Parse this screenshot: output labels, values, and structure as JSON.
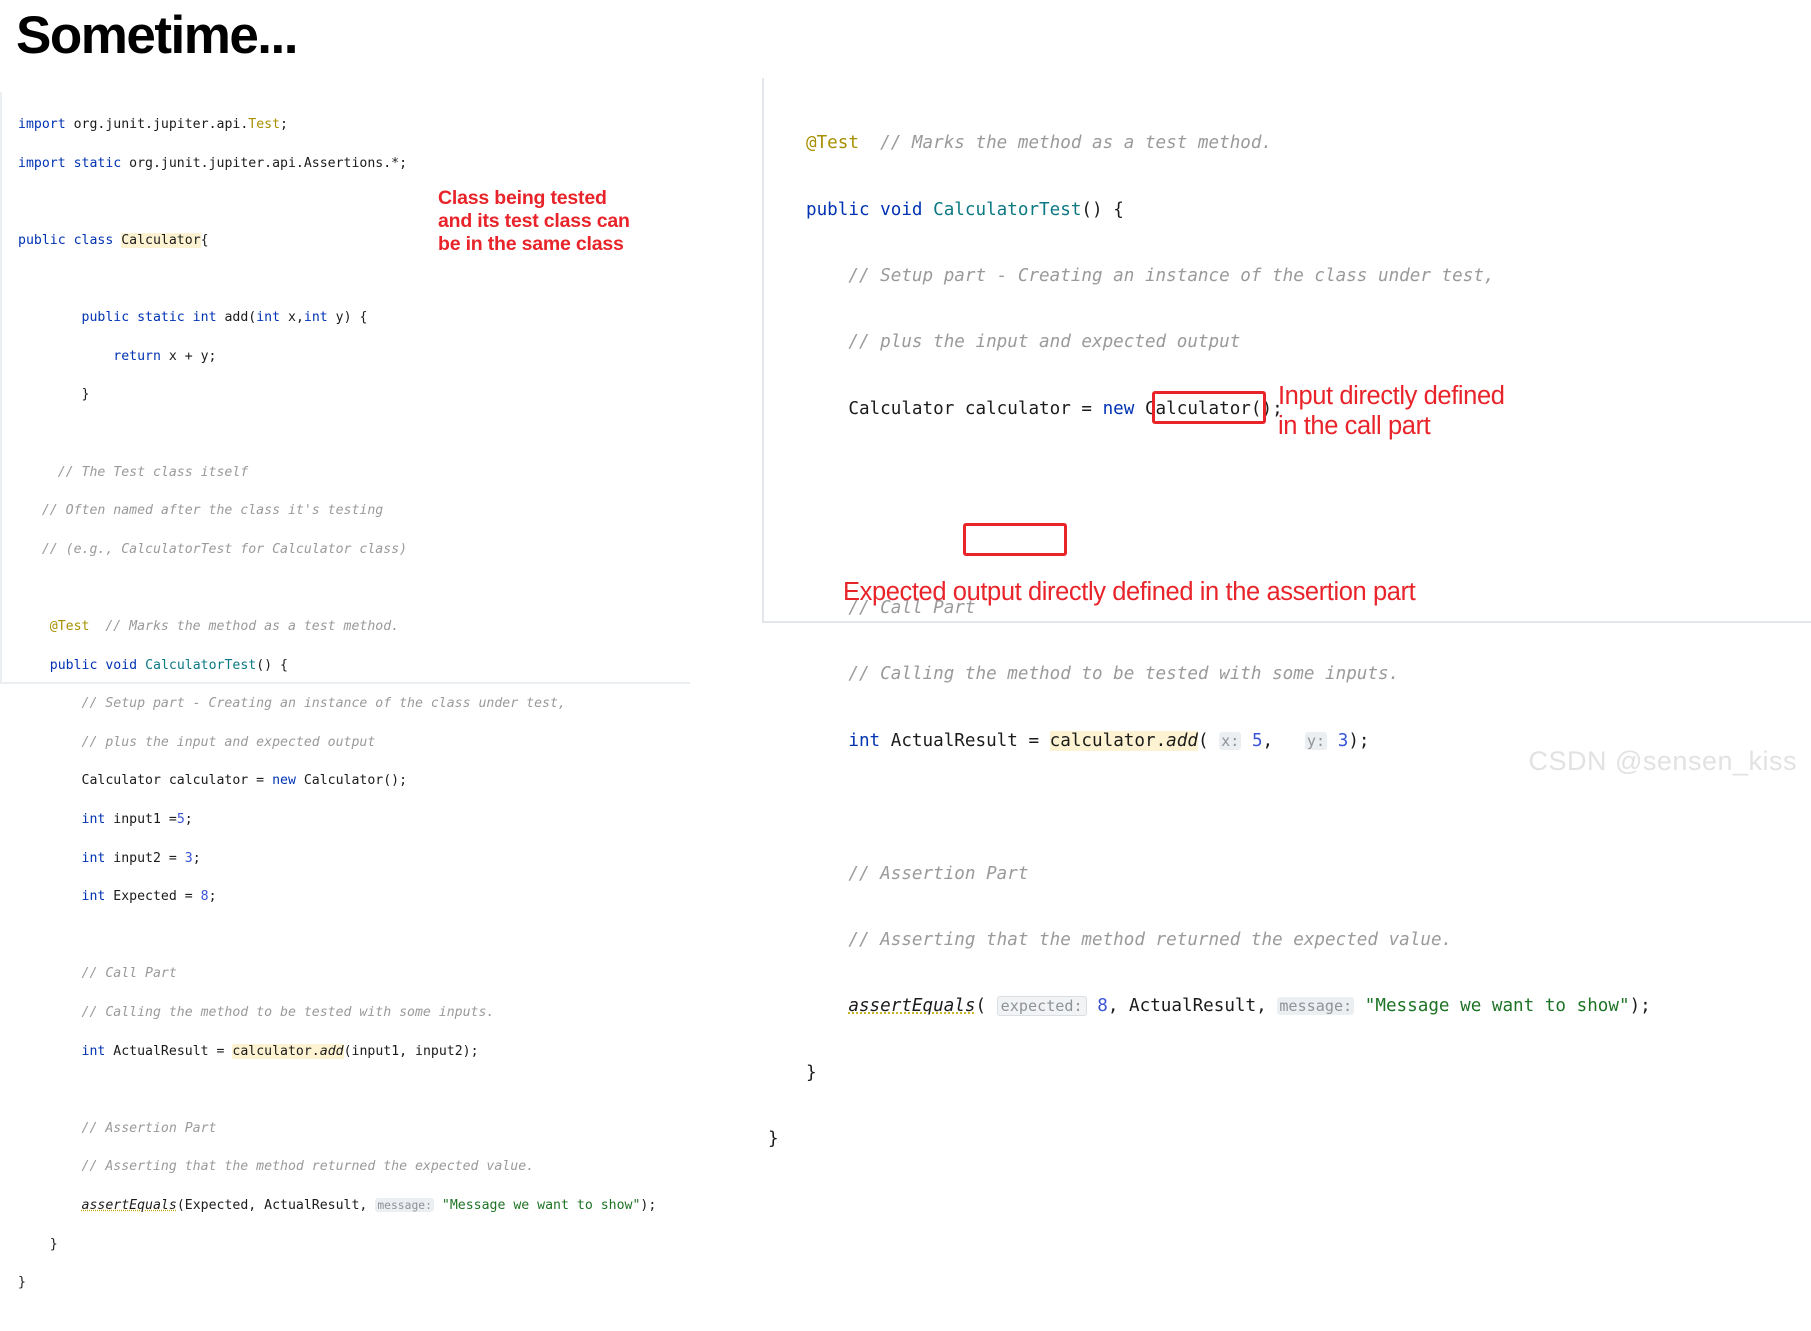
{
  "slide": {
    "title": "Sometime...",
    "accent_red": "#e8242a",
    "highlight_yellow": "#fdf3d2",
    "watermark": "CSDN @sensen_kiss"
  },
  "left_panel": {
    "name": "java-source-full-class",
    "lines": [
      "import org.junit.jupiter.api.Test;",
      "import static org.junit.jupiter.api.Assertions.*;",
      "",
      "public class Calculator{",
      "",
      "        public static int add(int x,int y) {",
      "            return x + y;",
      "        }",
      "",
      "     // The Test class itself",
      "   // Often named after the class it's testing",
      "   // (e.g., CalculatorTest for Calculator class)",
      "",
      "    @Test  // Marks the method as a test method.",
      "    public void CalculatorTest() {",
      "        // Setup part - Creating an instance of the class under test,",
      "        // plus the input and expected output",
      "        Calculator calculator = new Calculator();",
      "        int input1 =5;",
      "        int input2 = 3;",
      "        int Expected = 8;",
      "",
      "        // Call Part",
      "        // Calling the method to be tested with some inputs.",
      "        int ActualResult = calculator.add(input1, input2);",
      "",
      "        // Assertion Part",
      "        // Asserting that the method returned the expected value.",
      "        assertEquals(Expected, ActualResult, message: \"Message we want to show\");",
      "    }",
      "}"
    ]
  },
  "right_panel": {
    "name": "java-source-test-method-zoom",
    "lines": [
      "@Test  // Marks the method as a test method.",
      "public void CalculatorTest() {",
      "    // Setup part - Creating an instance of the class under test,",
      "    // plus the input and expected output",
      "    Calculator calculator = new Calculator();",
      "",
      "",
      "    // Call Part",
      "    // Calling the method to be tested with some inputs.",
      "    int ActualResult = calculator.add( x: 5,   y: 3);",
      "",
      "    // Assertion Part",
      "    // Asserting that the method returned the expected value.",
      "    assertEquals( expected: 8, ActualResult, message: \"Message we want to show\");",
      "}",
      "}"
    ],
    "param_hints": {
      "x_label": "x:",
      "x_value": "5",
      "y_label": "y:",
      "y_value": "3",
      "expected_label": "expected:",
      "expected_value": "8",
      "message_label": "message:",
      "message_value": "\"Message we want to show\""
    }
  },
  "annotations": {
    "class_note": "Class being tested\nand its test class can\nbe in the same class",
    "input_note": "Input directly defined\nin the call part",
    "expected_note": "Expected output directly defined in the assertion part"
  }
}
